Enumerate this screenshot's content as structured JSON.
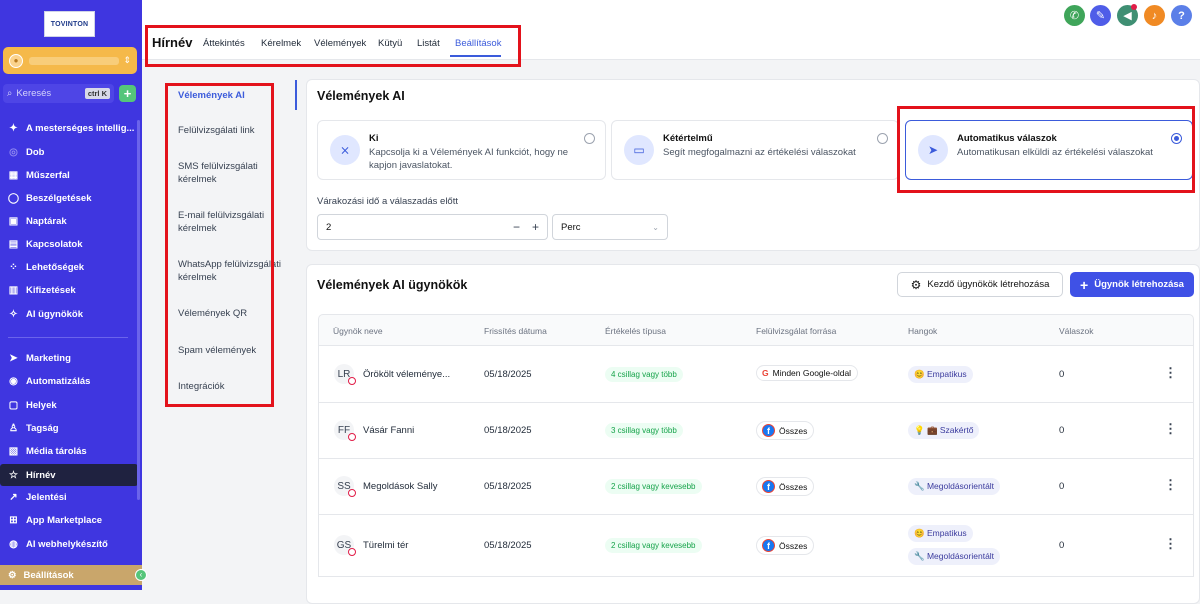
{
  "sidebar": {
    "logo_text": "TOVINTON",
    "search_placeholder": "Keresés",
    "search_shortcut": "ctrl K",
    "add_label": "+",
    "items": [
      {
        "label": "A mesterséges intellig...",
        "icon": "sparkle-icon"
      },
      {
        "label": "Dob",
        "icon": "rocket-icon"
      },
      {
        "label": "Műszerfal",
        "icon": "dashboard-icon"
      },
      {
        "label": "Beszélgetések",
        "icon": "chat-icon"
      },
      {
        "label": "Naptárak",
        "icon": "calendar-icon"
      },
      {
        "label": "Kapcsolatok",
        "icon": "contacts-icon"
      },
      {
        "label": "Lehetőségek",
        "icon": "opportunities-icon"
      },
      {
        "label": "Kifizetések",
        "icon": "payments-icon"
      },
      {
        "label": "AI ügynökök",
        "icon": "ai-agents-icon"
      },
      {
        "label": "Marketing",
        "icon": "send-icon"
      },
      {
        "label": "Automatizálás",
        "icon": "automation-icon"
      },
      {
        "label": "Helyek",
        "icon": "sites-icon"
      },
      {
        "label": "Tagság",
        "icon": "membership-icon"
      },
      {
        "label": "Média tárolás",
        "icon": "media-icon"
      },
      {
        "label": "Hírnév",
        "icon": "star-icon"
      },
      {
        "label": "Jelentési",
        "icon": "reporting-icon"
      },
      {
        "label": "App Marketplace",
        "icon": "marketplace-icon"
      },
      {
        "label": "AI webhelykészítő",
        "icon": "ai-builder-icon"
      }
    ],
    "settings_label": "Beállítások",
    "collapse_label": "‹"
  },
  "header": {
    "title": "Hírnév",
    "tabs": [
      {
        "label": "Áttekintés"
      },
      {
        "label": "Kérelmek"
      },
      {
        "label": "Vélemények"
      },
      {
        "label": "Kütyü"
      },
      {
        "label": "Listát"
      },
      {
        "label": "Beállítások"
      }
    ],
    "active_tab": "Beállítások",
    "help_label": "?"
  },
  "subnav": {
    "items": [
      {
        "label": "Vélemények AI"
      },
      {
        "label": "Felülvizsgálati link"
      },
      {
        "label": "SMS felülvizsgálati kérelmek"
      },
      {
        "label": "E-mail felülvizsgálati kérelmek"
      },
      {
        "label": "WhatsApp felülvizsgálati kérelmek"
      },
      {
        "label": "Vélemények QR"
      },
      {
        "label": "Spam vélemények"
      },
      {
        "label": "Integrációk"
      }
    ]
  },
  "ai_settings": {
    "title": "Vélemények AI",
    "options": [
      {
        "title": "Ki",
        "desc": "Kapcsolja ki a Vélemények AI funkciót, hogy ne kapjon javaslatokat.",
        "selected": false
      },
      {
        "title": "Kétértelmű",
        "desc": "Segít megfogalmazni az értékelési válaszokat",
        "selected": false
      },
      {
        "title": "Automatikus válaszok",
        "desc": "Automatikusan elküldi az értékelési válaszokat",
        "selected": true
      }
    ],
    "wait_label": "Várakozási idő a válaszadás előtt",
    "wait_value": "2",
    "minus": "−",
    "plus": "+",
    "unit": "Perc"
  },
  "agents": {
    "title": "Vélemények AI ügynökök",
    "create_default_label": "Kezdő ügynökök létrehozása",
    "create_label": "Ügynök létrehozása",
    "columns": [
      "Ügynök neve",
      "Frissítés dátuma",
      "Értékelés típusa",
      "Felülvizsgálat forrása",
      "Hangok",
      "Válaszok"
    ],
    "rows": [
      {
        "initials": "LR",
        "name": "Örökölt véleménye...",
        "date": "05/18/2025",
        "rating": "4 csillag vagy több",
        "source": "Minden Google-oldal",
        "source_type": "google",
        "tones": [
          "😊 Empatikus"
        ],
        "replies": "0"
      },
      {
        "initials": "FF",
        "name": "Vásár Fanni",
        "date": "05/18/2025",
        "rating": "3 csillag vagy több",
        "source": "Összes",
        "source_type": "facebook",
        "tones": [
          "💡 💼 Szakértő"
        ],
        "replies": "0"
      },
      {
        "initials": "SS",
        "name": "Megoldások Sally",
        "date": "05/18/2025",
        "rating": "2 csillag vagy kevesebb",
        "source": "Összes",
        "source_type": "facebook",
        "tones": [
          "🔧 Megoldásorientált"
        ],
        "replies": "0"
      },
      {
        "initials": "GS",
        "name": "Türelmi tér",
        "date": "05/18/2025",
        "rating": "2 csillag vagy kevesebb",
        "source": "Összes",
        "source_type": "facebook",
        "tones": [
          "😊 Empatikus",
          "🔧 Megoldásorientált"
        ],
        "replies": "0"
      }
    ]
  },
  "colors": {
    "sidebar": "#3f36e0",
    "accent": "#3b5bdb",
    "highlight": "#e3121b"
  }
}
